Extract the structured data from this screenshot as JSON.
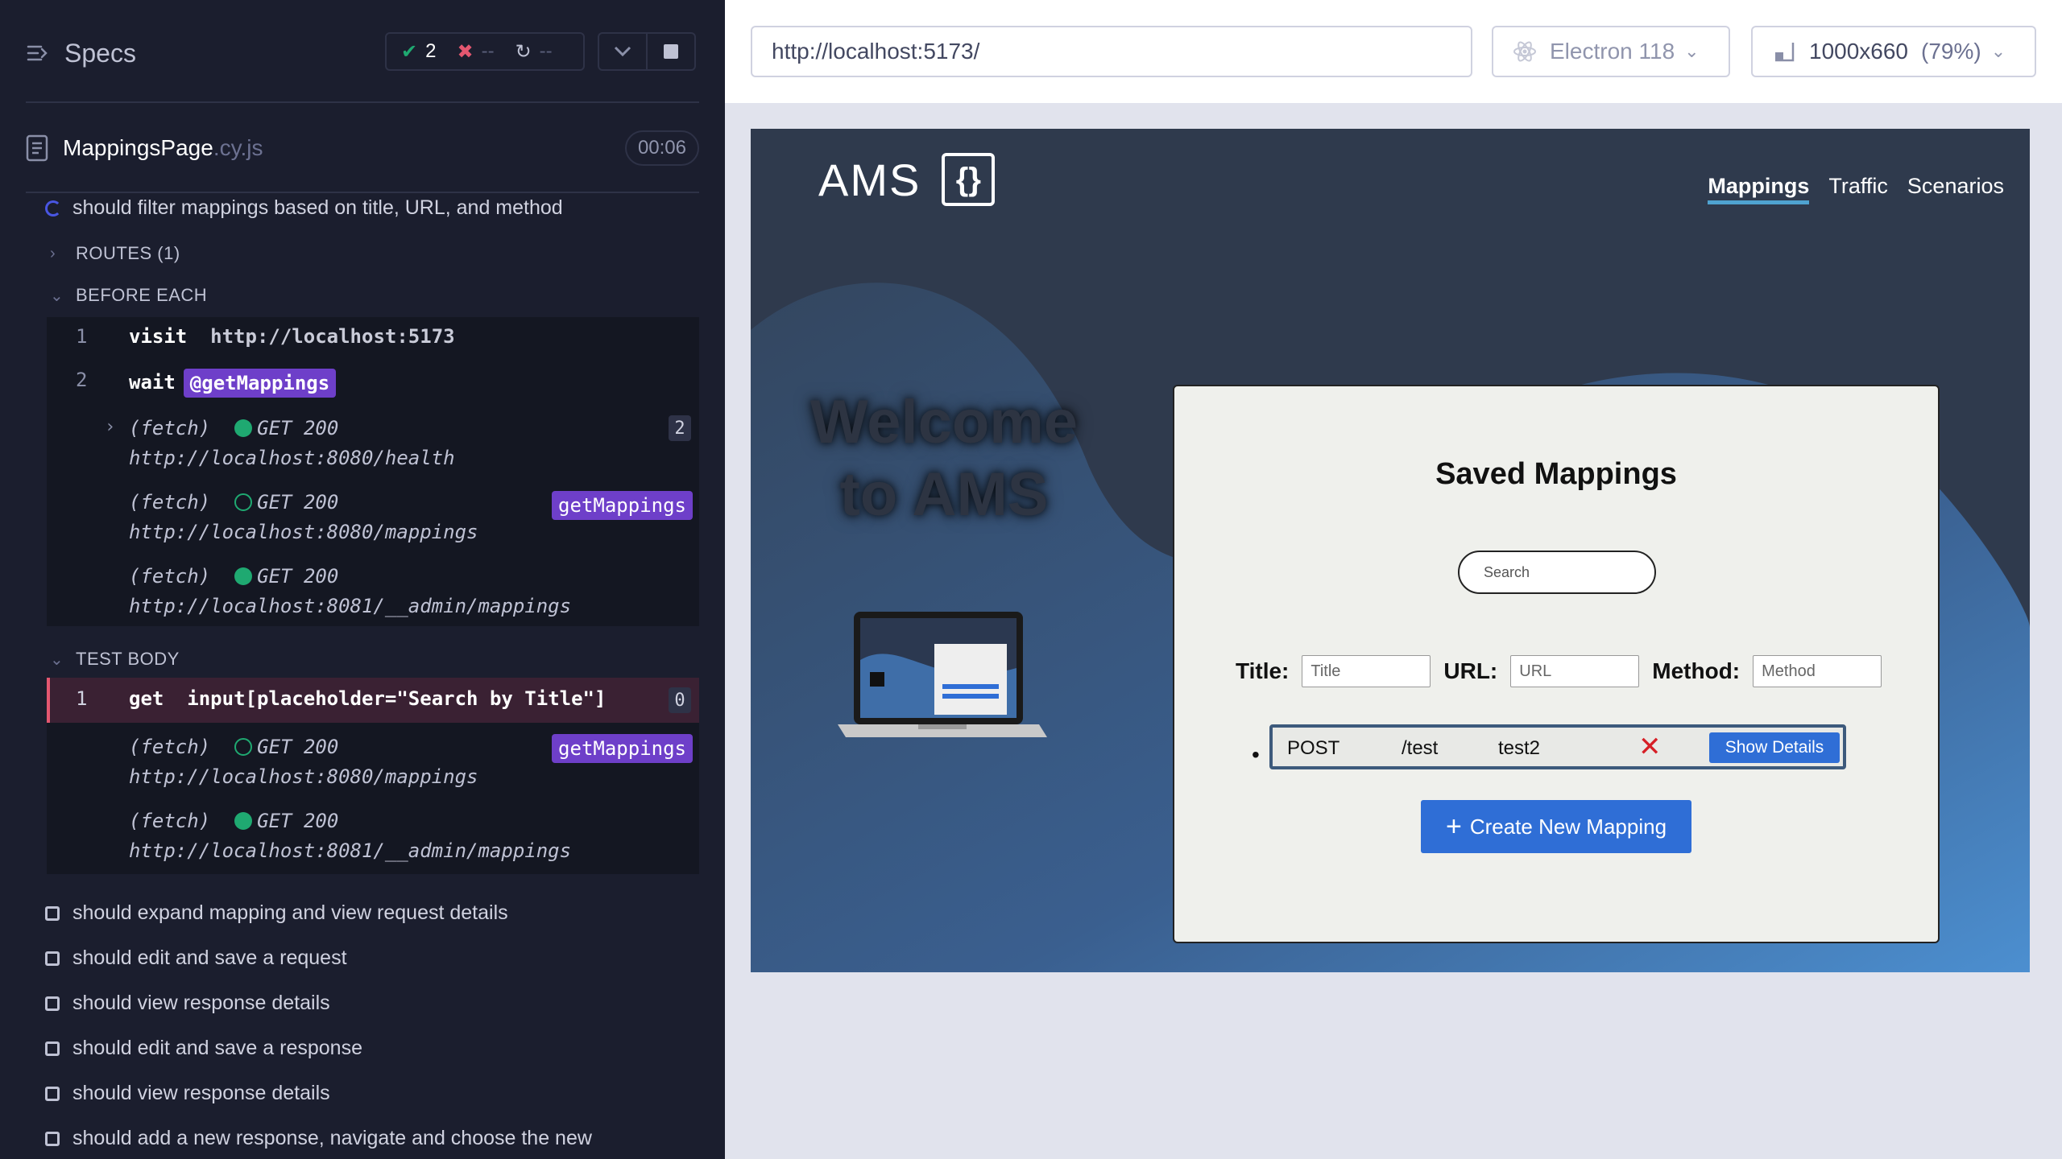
{
  "reporter": {
    "specs_label": "Specs",
    "stats": {
      "passed": "2",
      "failed": "--",
      "pending": "--"
    },
    "file": {
      "name": "MappingsPage",
      "ext": ".cy.js",
      "duration": "00:06"
    },
    "current_test": "should filter mappings based on title, URL, and method",
    "routes_label": "ROUTES (1)",
    "before_each_label": "BEFORE EACH",
    "test_body_label": "TEST BODY",
    "before_each_cmds": [
      {
        "num": "1",
        "name": "visit",
        "arg": "http://localhost:5173"
      },
      {
        "num": "2",
        "name": "wait",
        "alias": "@getMappings"
      }
    ],
    "before_fetches": [
      {
        "label": "(fetch)",
        "status": "GET 200",
        "url": "http://localhost:8080/health",
        "count": "2"
      },
      {
        "label": "(fetch)",
        "status": "GET 200",
        "url": "http://localhost:8080/mappings",
        "alias": "getMappings"
      },
      {
        "label": "(fetch)",
        "status": "GET 200",
        "url": "http://localhost:8081/__admin/mappings"
      }
    ],
    "body_cmd": {
      "num": "1",
      "name": "get",
      "arg": "input[placeholder=\"Search by Title\"]",
      "count": "0"
    },
    "body_fetches": [
      {
        "label": "(fetch)",
        "status": "GET 200",
        "url": "http://localhost:8080/mappings",
        "alias": "getMappings"
      },
      {
        "label": "(fetch)",
        "status": "GET 200",
        "url": "http://localhost:8081/__admin/mappings"
      }
    ],
    "pending_tests": [
      "should expand mapping and view request details",
      "should edit and save a request",
      "should view response details",
      "should edit and save a response",
      "should view response details",
      "should add a new response, navigate and choose the new"
    ]
  },
  "toolbar": {
    "url": "http://localhost:5173/",
    "browser": "Electron 118",
    "viewport": "1000x660",
    "scale": "(79%)"
  },
  "app": {
    "logo": "AMS",
    "logo_mark": "{}",
    "nav": [
      "Mappings",
      "Traffic",
      "Scenarios"
    ],
    "welcome": "Welcome to AMS",
    "card_title": "Saved Mappings",
    "search_placeholder": "Search",
    "filters": {
      "title_label": "Title:",
      "title_placeholder": "Title",
      "url_label": "URL:",
      "url_placeholder": "URL",
      "method_label": "Method:",
      "method_placeholder": "Method"
    },
    "mapping": {
      "method": "POST",
      "url": "/test",
      "title": "test2",
      "delete": "✕",
      "show_details": "Show Details"
    },
    "create_button": "Create New Mapping"
  },
  "colors": {
    "accent": "#2f6ed6",
    "pass": "#1fa971",
    "fail": "#e45770",
    "alias": "#6e3fc9"
  },
  "icons": [
    "specs-icon",
    "check-icon",
    "x-icon",
    "spinner-icon",
    "chevron-down-icon",
    "stop-icon",
    "file-icon",
    "chevron-right-icon",
    "electron-icon",
    "viewport-icon",
    "delete-icon",
    "plus-icon"
  ]
}
